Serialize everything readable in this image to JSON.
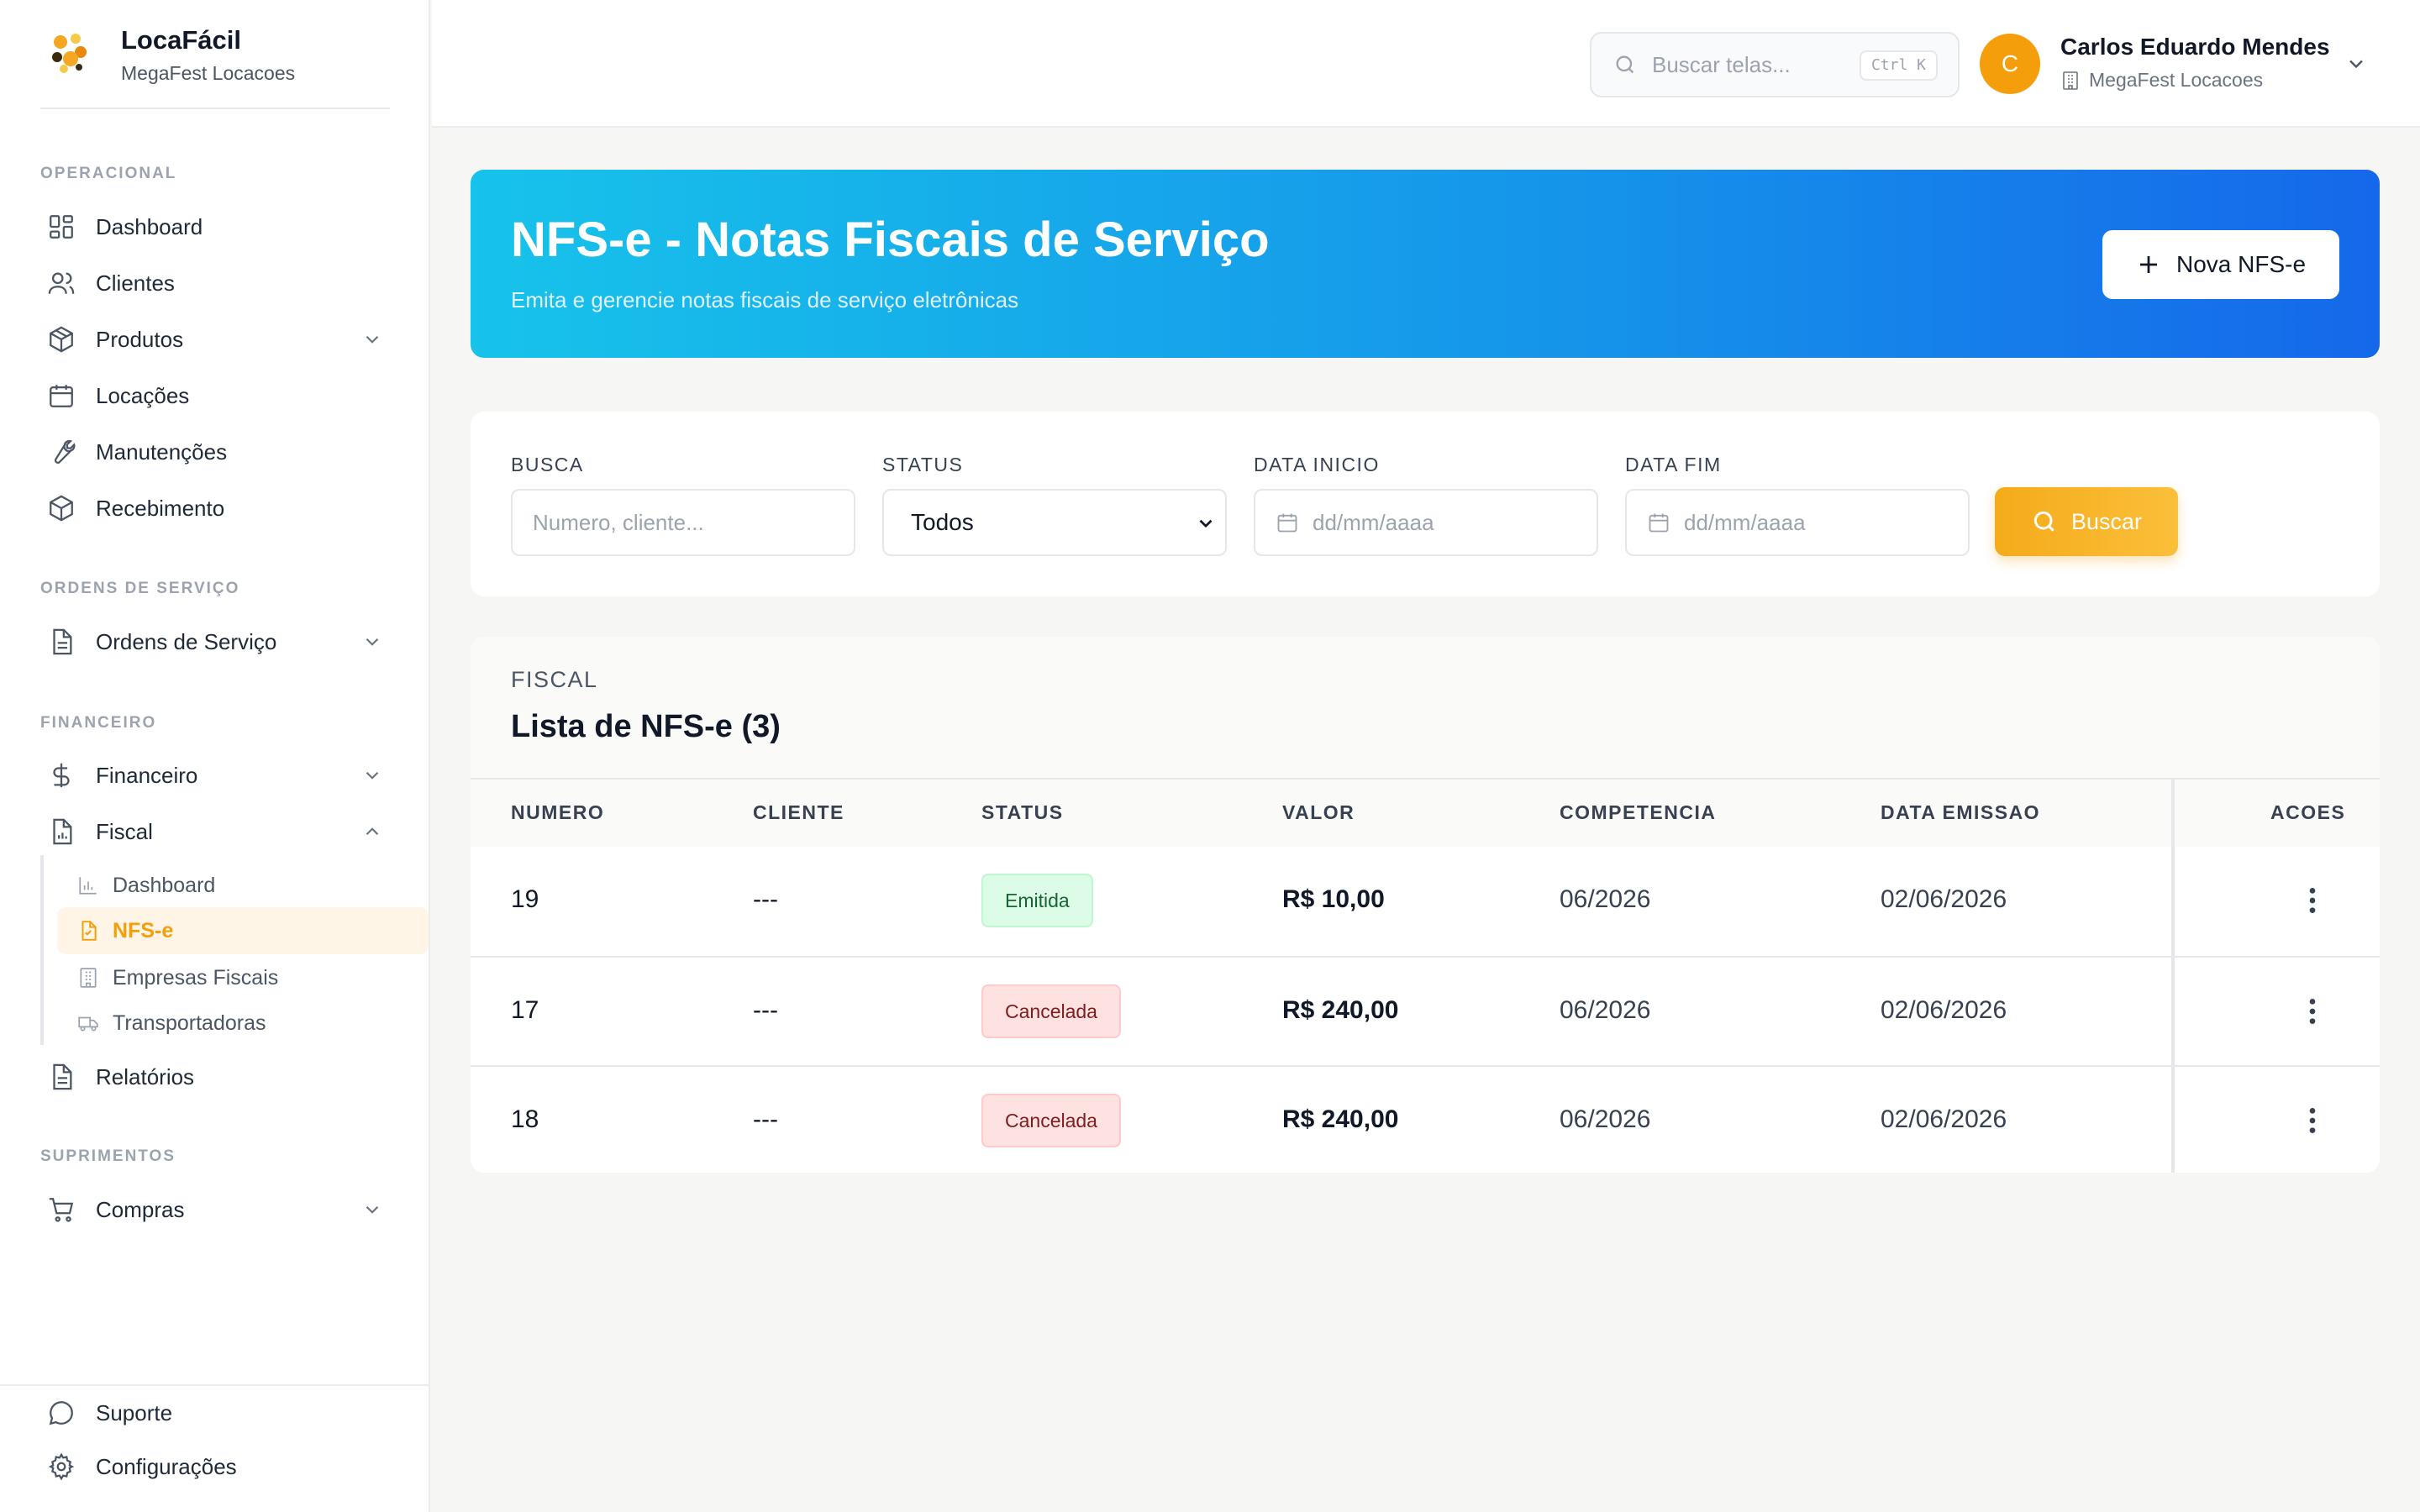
{
  "brand": {
    "name": "LocaFácil",
    "subtitle": "MegaFest Locacoes"
  },
  "sidebar": {
    "sections": {
      "operacional": "OPERACIONAL",
      "ordens": "ORDENS DE SERVIÇO",
      "financeiro": "FINANCEIRO",
      "suprimentos": "SUPRIMENTOS"
    },
    "items": {
      "dashboard": "Dashboard",
      "clientes": "Clientes",
      "produtos": "Produtos",
      "locacoes": "Locações",
      "manutencoes": "Manutenções",
      "recebimento": "Recebimento",
      "ordens_servico": "Ordens de Serviço",
      "financeiro": "Financeiro",
      "fiscal": "Fiscal",
      "relatorios": "Relatórios",
      "compras": "Compras",
      "suporte": "Suporte",
      "configuracoes": "Configurações"
    },
    "fiscal_sub": {
      "dashboard": "Dashboard",
      "nfse": "NFS-e",
      "empresas": "Empresas Fiscais",
      "transportadoras": "Transportadoras"
    }
  },
  "header": {
    "search_placeholder": "Buscar telas...",
    "shortcut": "Ctrl K",
    "user_initial": "C",
    "user_name": "Carlos Eduardo Mendes",
    "user_org": "MegaFest Locacoes"
  },
  "hero": {
    "title": "NFS-e - Notas Fiscais de Serviço",
    "subtitle": "Emita e gerencie notas fiscais de serviço eletrônicas",
    "button": "Nova NFS-e"
  },
  "filters": {
    "busca_label": "BUSCA",
    "busca_placeholder": "Numero, cliente...",
    "status_label": "STATUS",
    "status_value": "Todos",
    "data_inicio_label": "DATA INICIO",
    "data_fim_label": "DATA FIM",
    "date_placeholder": "dd/mm/aaaa",
    "buscar": "Buscar"
  },
  "table": {
    "eyebrow": "FISCAL",
    "title": "Lista de NFS-e (3)",
    "headers": {
      "numero": "NUMERO",
      "cliente": "CLIENTE",
      "status": "STATUS",
      "valor": "VALOR",
      "competencia": "COMPETENCIA",
      "data_emissao": "DATA EMISSAO",
      "acoes": "ACOES"
    },
    "rows": [
      {
        "numero": "19",
        "cliente": "---",
        "status": "Emitida",
        "valor": "R$ 10,00",
        "competencia": "06/2026",
        "data_emissao": "02/06/2026"
      },
      {
        "numero": "17",
        "cliente": "---",
        "status": "Cancelada",
        "valor": "R$ 240,00",
        "competencia": "06/2026",
        "data_emissao": "02/06/2026"
      },
      {
        "numero": "18",
        "cliente": "---",
        "status": "Cancelada",
        "valor": "R$ 240,00",
        "competencia": "06/2026",
        "data_emissao": "02/06/2026"
      }
    ]
  },
  "colors": {
    "accent": "#f59e0b",
    "hero_start": "#17c3ea",
    "hero_end": "#1568ea",
    "status_emitida": "#dcfce7",
    "status_cancelada": "#fee2e2"
  }
}
